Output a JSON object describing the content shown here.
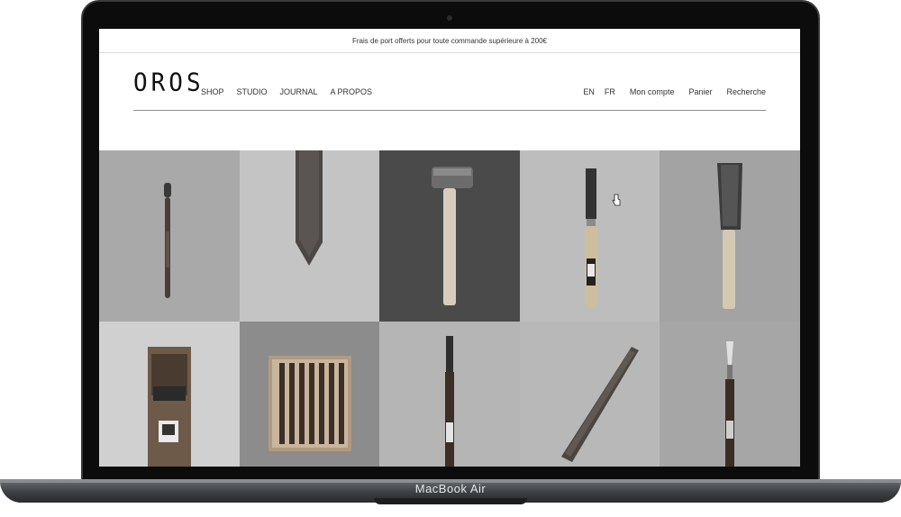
{
  "device": {
    "model_label": "MacBook Air"
  },
  "site": {
    "promo_text": "Frais de port offerts pour toute commande supérieure à 200€",
    "logo_text": "OROS",
    "nav_left": [
      {
        "label": "SHOP"
      },
      {
        "label": "STUDIO"
      },
      {
        "label": "JOURNAL"
      },
      {
        "label": "A PROPOS"
      }
    ],
    "languages": [
      {
        "label": "EN"
      },
      {
        "label": "FR"
      }
    ],
    "nav_right": [
      {
        "label": "Mon compte"
      },
      {
        "label": "Panier"
      },
      {
        "label": "Recherche"
      }
    ]
  },
  "products": [
    {
      "icon": "carving-tool-icon",
      "bg": "#a9a9a9"
    },
    {
      "icon": "knife-blade-icon",
      "bg": "#c4c4c4"
    },
    {
      "icon": "hammer-icon",
      "bg": "#4a4a4a"
    },
    {
      "icon": "chisel-icon",
      "bg": "#bdbdbd"
    },
    {
      "icon": "saw-icon",
      "bg": "#a3a3a3"
    },
    {
      "icon": "hand-plane-icon",
      "bg": "#d0d0d0"
    },
    {
      "icon": "chisel-set-icon",
      "bg": "#8c8c8c"
    },
    {
      "icon": "long-chisel-icon",
      "bg": "#b5b5b5"
    },
    {
      "icon": "marking-knife-icon",
      "bg": "#b8b8b8"
    },
    {
      "icon": "skew-chisel-icon",
      "bg": "#a6a6a6"
    }
  ]
}
